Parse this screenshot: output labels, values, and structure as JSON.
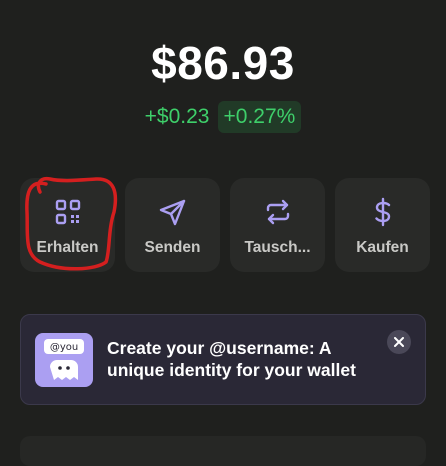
{
  "wallet": {
    "balance": "$86.93",
    "change_amount": "+$0.23",
    "change_percent": "+0.27%"
  },
  "actions": [
    {
      "label": "Erhalten",
      "icon": "qr-code-icon"
    },
    {
      "label": "Senden",
      "icon": "send-icon"
    },
    {
      "label": "Tausch...",
      "icon": "swap-icon"
    },
    {
      "label": "Kaufen",
      "icon": "dollar-icon"
    }
  ],
  "banner": {
    "icon_text": "@you",
    "text": "Create your @username: A unique identity for your wallet",
    "close_icon": "close-icon"
  },
  "colors": {
    "background": "#1f201e",
    "positive": "#3ecf6a",
    "accent": "#ab9ff2",
    "annotation": "#d41f1f"
  }
}
